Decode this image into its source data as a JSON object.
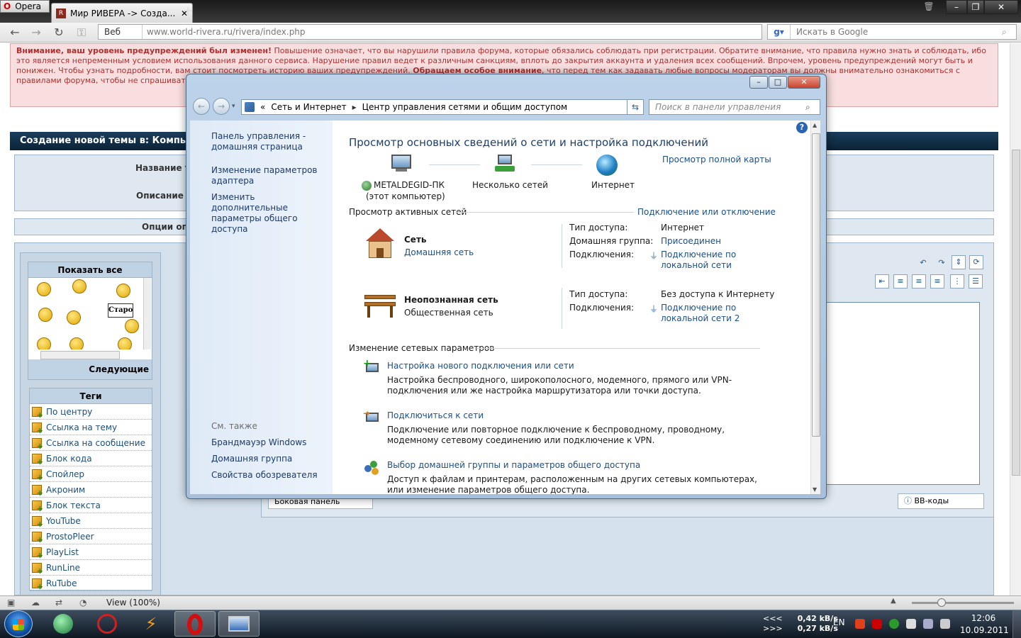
{
  "browser": {
    "menu_label": "Opera",
    "tab_title": "Мир РИВЕРА -> Созда...",
    "tab_favicon_text": "R",
    "address_mode": "Веб",
    "address_url": "www.world-rivera.ru/rivera/index.php",
    "search_placeholder": "Искать в Google",
    "status_zoom": "View (100%)"
  },
  "forum": {
    "warning_title": "Внимание, ваш уровень предупреждений был изменен!",
    "warning_text_1": " Повышение означает, что вы нарушили правила форума, которые обязались соблюдать при регистрации. Обратите внимание, что правила нужно знать и соблюдать, ибо это является непременным условием использования данного сервиса. Нарушение правил ведет к различным санкциям, вплоть до закрытия аккаунта и удаления всех сообщений. Впрочем, уровень предупреждений могут быть и понижен. Чтобы узнать подробности, вам стоит посмотреть историю ваших предупреждений. ",
    "warning_strong": "Обращаем особое внимание",
    "warning_text_2": ", что перед тем как задавать любые вопросы модераторам вы должны внимательно ознакомиться с правилами форума, чтобы не спрашивать",
    "header_title": "Создание новой темы в: Компы/со",
    "label_name": "Название т",
    "label_desc": "Описание т",
    "label_options": "Опции оп",
    "smileys_title": "Показать все",
    "smileys_next": "Следующие",
    "smiley_sign": "Старо",
    "tags_title": "Теги",
    "tags": [
      "По центру",
      "Ссылка на тему",
      "Ссылка на сообщение",
      "Блок кода",
      "Спойлер",
      "Акроним",
      "Блок текста",
      "YouTube",
      "ProstoPleer",
      "PlayList",
      "RunLine",
      "RuTube"
    ],
    "side_panel": "Боковая панель",
    "bbcodes": "BB-коды"
  },
  "cpanel": {
    "breadcrumb_prefix": "«",
    "breadcrumb_1": "Сеть и Интернет",
    "breadcrumb_sep": "▸",
    "breadcrumb_2": "Центр управления сетями и общим доступом",
    "search_placeholder": "Поиск в панели управления",
    "left_links": [
      "Панель управления - домашняя страница",
      "Изменение параметров адаптера",
      "Изменить дополнительные параметры общего доступа"
    ],
    "see_also": "См. также",
    "see_also_links": [
      "Брандмауэр Windows",
      "Домашняя группа",
      "Свойства обозревателя"
    ],
    "heading": "Просмотр основных сведений о сети и настройка подключений",
    "full_map": "Просмотр полной карты",
    "node_pc_name": "METALDEGID-ПК",
    "node_pc_sub": "(этот компьютер)",
    "node_multi": "Несколько сетей",
    "node_internet": "Интернет",
    "active_header": "Просмотр активных сетей",
    "connect_toggle": "Подключение или отключение",
    "networks": [
      {
        "name": "Сеть",
        "type_link": "Домашняя сеть",
        "access_label": "Тип доступа:",
        "access": "Интернет",
        "homegroup_label": "Домашняя группа:",
        "homegroup": "Присоединен",
        "conn_label": "Подключения:",
        "conn": "Подключение по локальной сети"
      },
      {
        "name": "Неопознанная сеть",
        "type_text": "Общественная сеть",
        "access_label": "Тип доступа:",
        "access": "Без доступа к Интернету",
        "conn_label": "Подключения:",
        "conn": "Подключение по локальной сети 2"
      }
    ],
    "change_header": "Изменение сетевых параметров",
    "tasks": [
      {
        "title": "Настройка нового подключения или сети",
        "desc": "Настройка беспроводного, широкополосного, модемного, прямого или VPN-подключения или же настройка маршрутизатора или точки доступа."
      },
      {
        "title": "Подключиться к сети",
        "desc": "Подключение или повторное подключение к беспроводному, проводному, модемному сетевому соединению или подключение к VPN."
      },
      {
        "title": "Выбор домашней группы и параметров общего доступа",
        "desc": "Доступ к файлам и принтерам, расположенным на других сетевых компьютерах, или изменение параметров общего доступа."
      }
    ]
  },
  "taskbar": {
    "up_arrows": "<<<",
    "down_arrows": ">>>",
    "up_speed": "0,42 kB/s",
    "down_speed": "0,27 kB/s",
    "lang": "EN",
    "time": "12:06",
    "date": "10.09.2011"
  },
  "colors": {
    "link": "#1a4f8b",
    "forum_header": "#0a2236",
    "warning_bg": "#f8dede",
    "window_frame": "#bcd3ea"
  }
}
